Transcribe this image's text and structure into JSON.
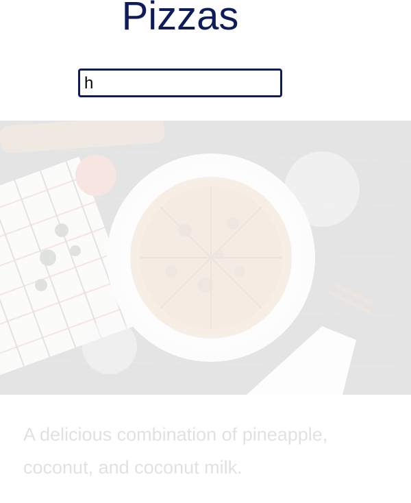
{
  "header": {
    "title": "Pizzas"
  },
  "search": {
    "value": "h"
  },
  "card": {
    "image_icon": "pizza-photo",
    "description": "A delicious combination of pineapple, coconut, and coconut milk."
  }
}
